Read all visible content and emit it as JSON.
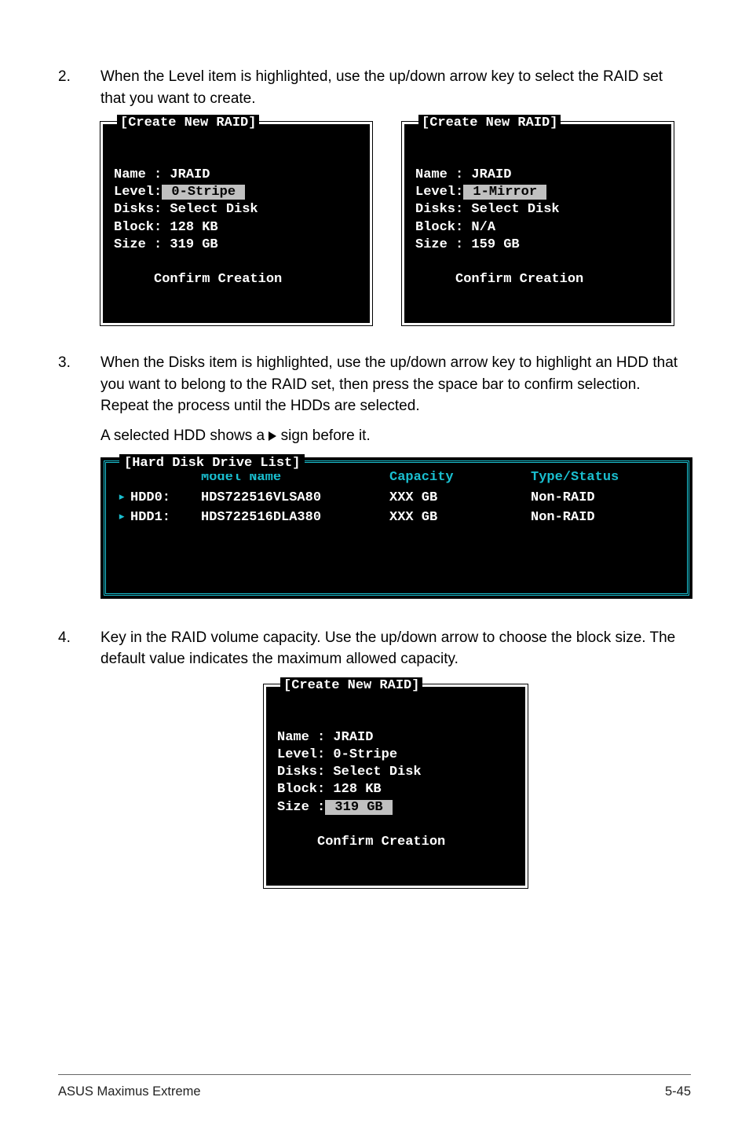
{
  "steps": {
    "s2": {
      "num": "2.",
      "text": "When the Level item is highlighted, use the up/down arrow key to select the RAID set that you want to create."
    },
    "s3": {
      "num": "3.",
      "text": "When the Disks item is highlighted, use the up/down arrow key to highlight an HDD that you want to belong to the RAID set, then press the space bar to confirm selection. Repeat the process until the HDDs are selected.",
      "aux_pre": "A selected HDD shows a ",
      "aux_post": " sign before it."
    },
    "s4": {
      "num": "4.",
      "text": "Key in the RAID volume capacity. Use the up/down arrow to choose the block size. The default value indicates the maximum allowed capacity."
    }
  },
  "box_a": {
    "title": "[Create New RAID]",
    "name_lbl": "Name :",
    "name_val": " JRAID",
    "level_lbl": "Level:",
    "level_val": " 0-Stripe ",
    "disks_lbl": "Disks:",
    "disks_val": " Select Disk",
    "block_lbl": "Block:",
    "block_val": " 128 KB",
    "size_lbl": "Size :",
    "size_val": " 319 GB",
    "confirm": "Confirm Creation"
  },
  "box_b": {
    "title": "[Create New RAID]",
    "name_lbl": "Name :",
    "name_val": " JRAID",
    "level_lbl": "Level:",
    "level_val": " 1-Mirror ",
    "disks_lbl": "Disks:",
    "disks_val": " Select Disk",
    "block_lbl": "Block:",
    "block_val": " N/A",
    "size_lbl": "Size :",
    "size_val": " 159 GB",
    "confirm": "Confirm Creation"
  },
  "disklist": {
    "title": "[Hard Disk Drive List]",
    "head": {
      "model": "Model Name",
      "cap": "Capacity",
      "ts": "Type/Status"
    },
    "rows": [
      {
        "id": "HDD0:",
        "model": "HDS722516VLSA80",
        "cap": "XXX GB",
        "ts": "Non-RAID"
      },
      {
        "id": "HDD1:",
        "model": "HDS722516DLA380",
        "cap": "XXX GB",
        "ts": "Non-RAID"
      }
    ]
  },
  "box_c": {
    "title": "[Create New RAID]",
    "name_lbl": "Name :",
    "name_val": " JRAID",
    "level_lbl": "Level:",
    "level_val": " 0-Stripe",
    "disks_lbl": "Disks:",
    "disks_val": " Select Disk",
    "block_lbl": "Block:",
    "block_val": " 128 KB",
    "size_lbl": "Size :",
    "size_val": " 319 GB ",
    "confirm": "Confirm Creation"
  },
  "footer": {
    "left": "ASUS Maximus Extreme",
    "right": "5-45"
  }
}
